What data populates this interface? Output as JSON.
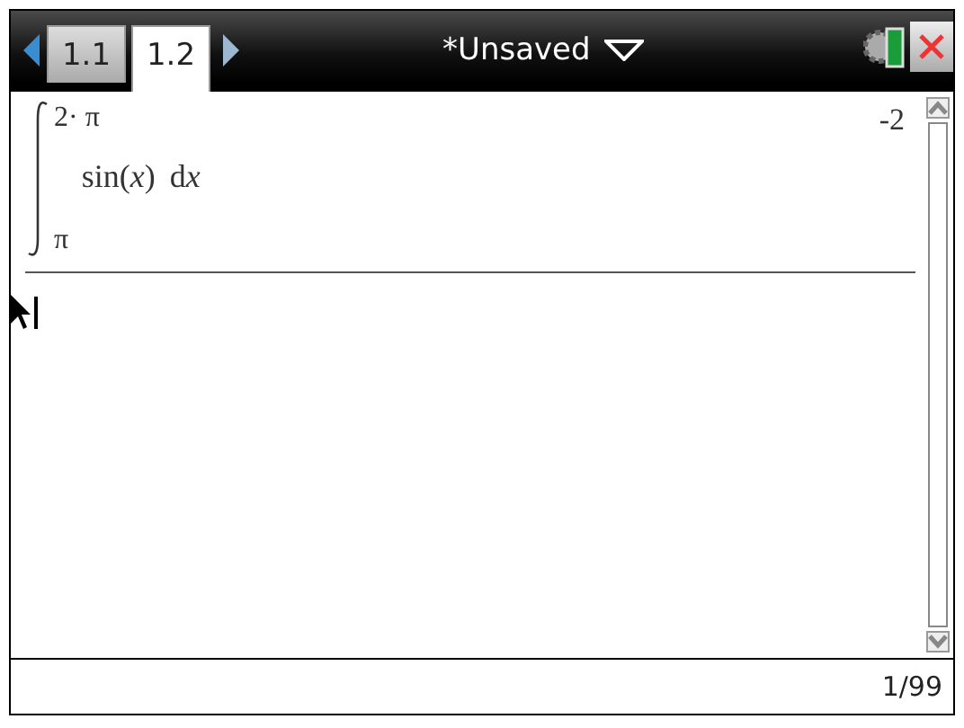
{
  "tabs": [
    {
      "label": "1.1",
      "selected": false
    },
    {
      "label": "1.2",
      "selected": true
    }
  ],
  "document": {
    "title": "*Unsaved"
  },
  "history": [
    {
      "upper": "2· π",
      "integrand": "sin(*x*)",
      "differential": "d",
      "variable": "x",
      "lower": "π",
      "result": "-2"
    }
  ],
  "status_bar": {
    "page": "1/99"
  }
}
